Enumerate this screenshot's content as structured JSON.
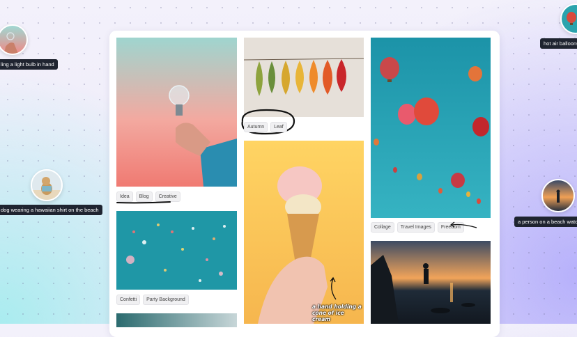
{
  "board": {
    "cards": [
      {
        "id": "lightbulb",
        "alt": "a hand holding a light bulb",
        "tags": [
          "Idea",
          "Blog",
          "Creative"
        ]
      },
      {
        "id": "leaves",
        "alt": "autumn leaves on a string",
        "tags": [
          "Autumn",
          "Leaf"
        ]
      },
      {
        "id": "balloons",
        "alt": "hot air balloons",
        "tags": [
          "Collage",
          "Travel Images",
          "Freedom"
        ]
      },
      {
        "id": "confetti",
        "alt": "confetti",
        "tags": [
          "Confetti",
          "Party Background"
        ]
      },
      {
        "id": "icecream",
        "alt": "a hand holding a cone of ice cream",
        "annotation": "a hand holding a cone of ice cream"
      },
      {
        "id": "beach",
        "alt": "a person on a beach at sunset"
      }
    ]
  },
  "floating_labels": [
    {
      "id": "lightbulb",
      "text": "ling a light bulb in hand"
    },
    {
      "id": "dog",
      "text": "dog wearing a hawaiian shirt on the beach"
    },
    {
      "id": "balloons",
      "text": "hot air balloons"
    },
    {
      "id": "beach",
      "text": "a person on a beach watchi"
    }
  ],
  "colors": {
    "label_bg": "#1f2430",
    "board_bg": "#ffffff",
    "tag_bg": "#f0f0f2"
  }
}
